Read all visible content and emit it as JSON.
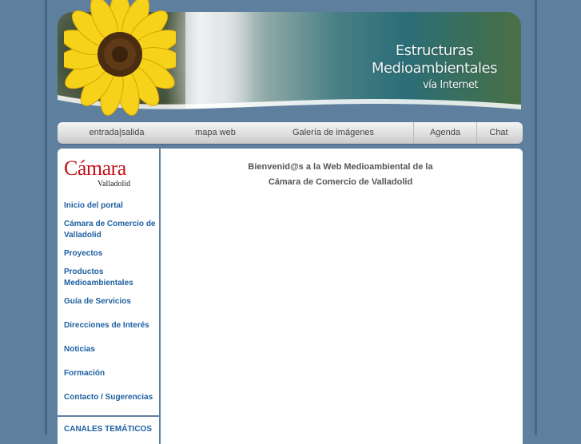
{
  "banner": {
    "title_line1": "Estructuras",
    "title_line2": "Medioambientales",
    "title_line3": "vía Internet"
  },
  "nav": {
    "items": [
      "entrada|salida",
      "mapa web",
      "Galería de imágenes",
      "Agenda",
      "Chat"
    ]
  },
  "logo": {
    "word": "Cámara",
    "sub": "Valladolid"
  },
  "sidebar": {
    "items": [
      "Inicio del portal",
      "Cámara de Comercio de Valladolid",
      "Proyectos",
      "Productos Medioambientales",
      "Guía de Servicios",
      "Direcciones de Interés",
      "Noticias",
      "Formación",
      "Contacto / Sugerencias"
    ],
    "channels_label": "CANALES TEMÁTICOS"
  },
  "main": {
    "welcome_line1": "Bienvenid@s a la Web Medioambiental de la",
    "welcome_line2": "Cámara de Comercio de Valladolid"
  },
  "colors": {
    "background": "#5f7f9f",
    "link": "#1e5fa0",
    "logo_red": "#c5121a"
  }
}
